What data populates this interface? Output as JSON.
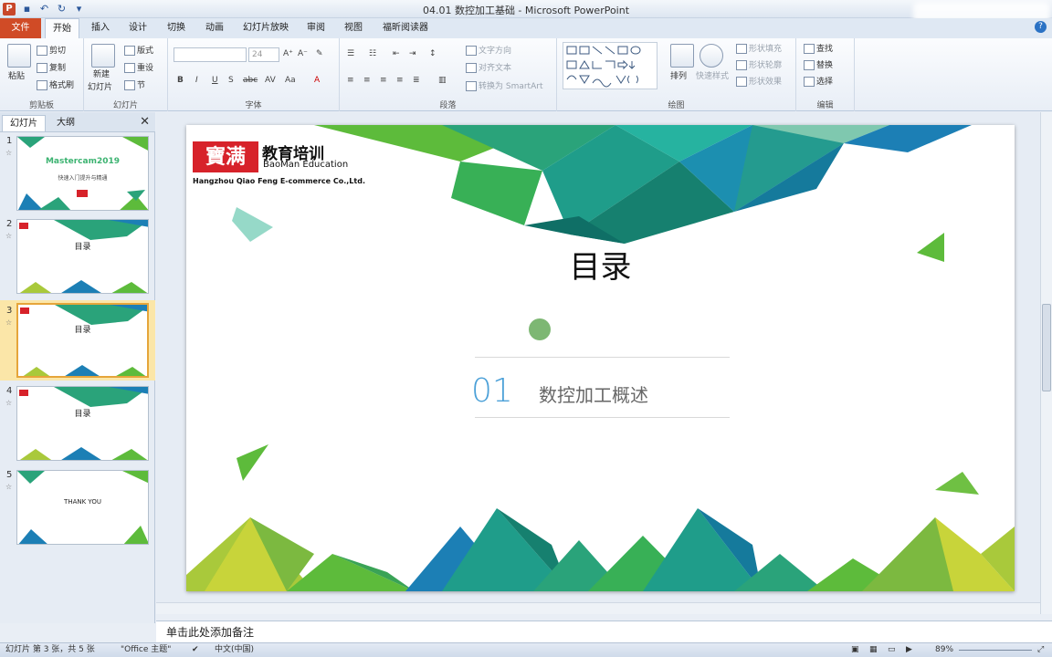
{
  "window": {
    "title": "04.01 数控加工基础 - Microsoft PowerPoint",
    "app_icon": "P",
    "qat_icons": [
      "save-icon",
      "undo-icon",
      "redo-icon",
      "customize-icon"
    ]
  },
  "tabs": [
    "文件",
    "开始",
    "插入",
    "设计",
    "切换",
    "动画",
    "幻灯片放映",
    "审阅",
    "视图",
    "福昕阅读器"
  ],
  "active_tab": "开始",
  "ribbon": {
    "clipboard": {
      "paste": "粘贴",
      "cut": "剪切",
      "copy": "复制",
      "format_painter": "格式刷",
      "label": "剪贴板"
    },
    "slides": {
      "new_slide": "新建",
      "new_slide2": "幻灯片",
      "layout": "版式",
      "reset": "重设",
      "section": "节",
      "label": "幻灯片"
    },
    "font": {
      "size": "24",
      "label": "字体",
      "bold": "B",
      "italic": "I",
      "underline": "U",
      "shadow": "S",
      "strike": "abc",
      "spacing": "AV",
      "case": "Aa",
      "color": "A"
    },
    "paragraph": {
      "text_direction": "文字方向",
      "align_text": "对齐文本",
      "smartart": "转换为 SmartArt",
      "label": "段落"
    },
    "drawing": {
      "arrange": "排列",
      "quick_styles": "快速样式",
      "shape_fill": "形状填充",
      "shape_outline": "形状轮廓",
      "shape_effects": "形状效果",
      "label": "绘图"
    },
    "editing": {
      "find": "查找",
      "replace": "替换",
      "select": "选择",
      "label": "编辑"
    }
  },
  "side_panel": {
    "tabs": [
      "幻灯片",
      "大纲"
    ],
    "thumbnails": [
      {
        "num": "1",
        "title": "Mastercam2019",
        "sub": "快速入门提升与精通"
      },
      {
        "num": "2",
        "title": "目录",
        "sub": ""
      },
      {
        "num": "3",
        "title": "目录",
        "sub": ""
      },
      {
        "num": "4",
        "title": "目录",
        "sub": ""
      },
      {
        "num": "5",
        "title": "THANK YOU",
        "sub": ""
      }
    ],
    "selected": 3
  },
  "slide": {
    "logo_cn": "寶满",
    "brand_cn": "教育培训",
    "brand_en": "BaoMan Education",
    "company": "Hangzhou Qiao Feng E-commerce Co.,Ltd.",
    "title": "目录",
    "item_number": "01",
    "item_text": "数控加工概述",
    "colors": {
      "green": "#5dbb3b",
      "teal": "#1f9d8a",
      "blue": "#1c7fb5",
      "yellow": "#d7d23a"
    }
  },
  "notes_placeholder": "单击此处添加备注",
  "status": {
    "slide_info": "幻灯片 第 3 张，共 5 张",
    "theme": "\"Office 主题\"",
    "language": "中文(中国)",
    "zoom": "89%"
  }
}
